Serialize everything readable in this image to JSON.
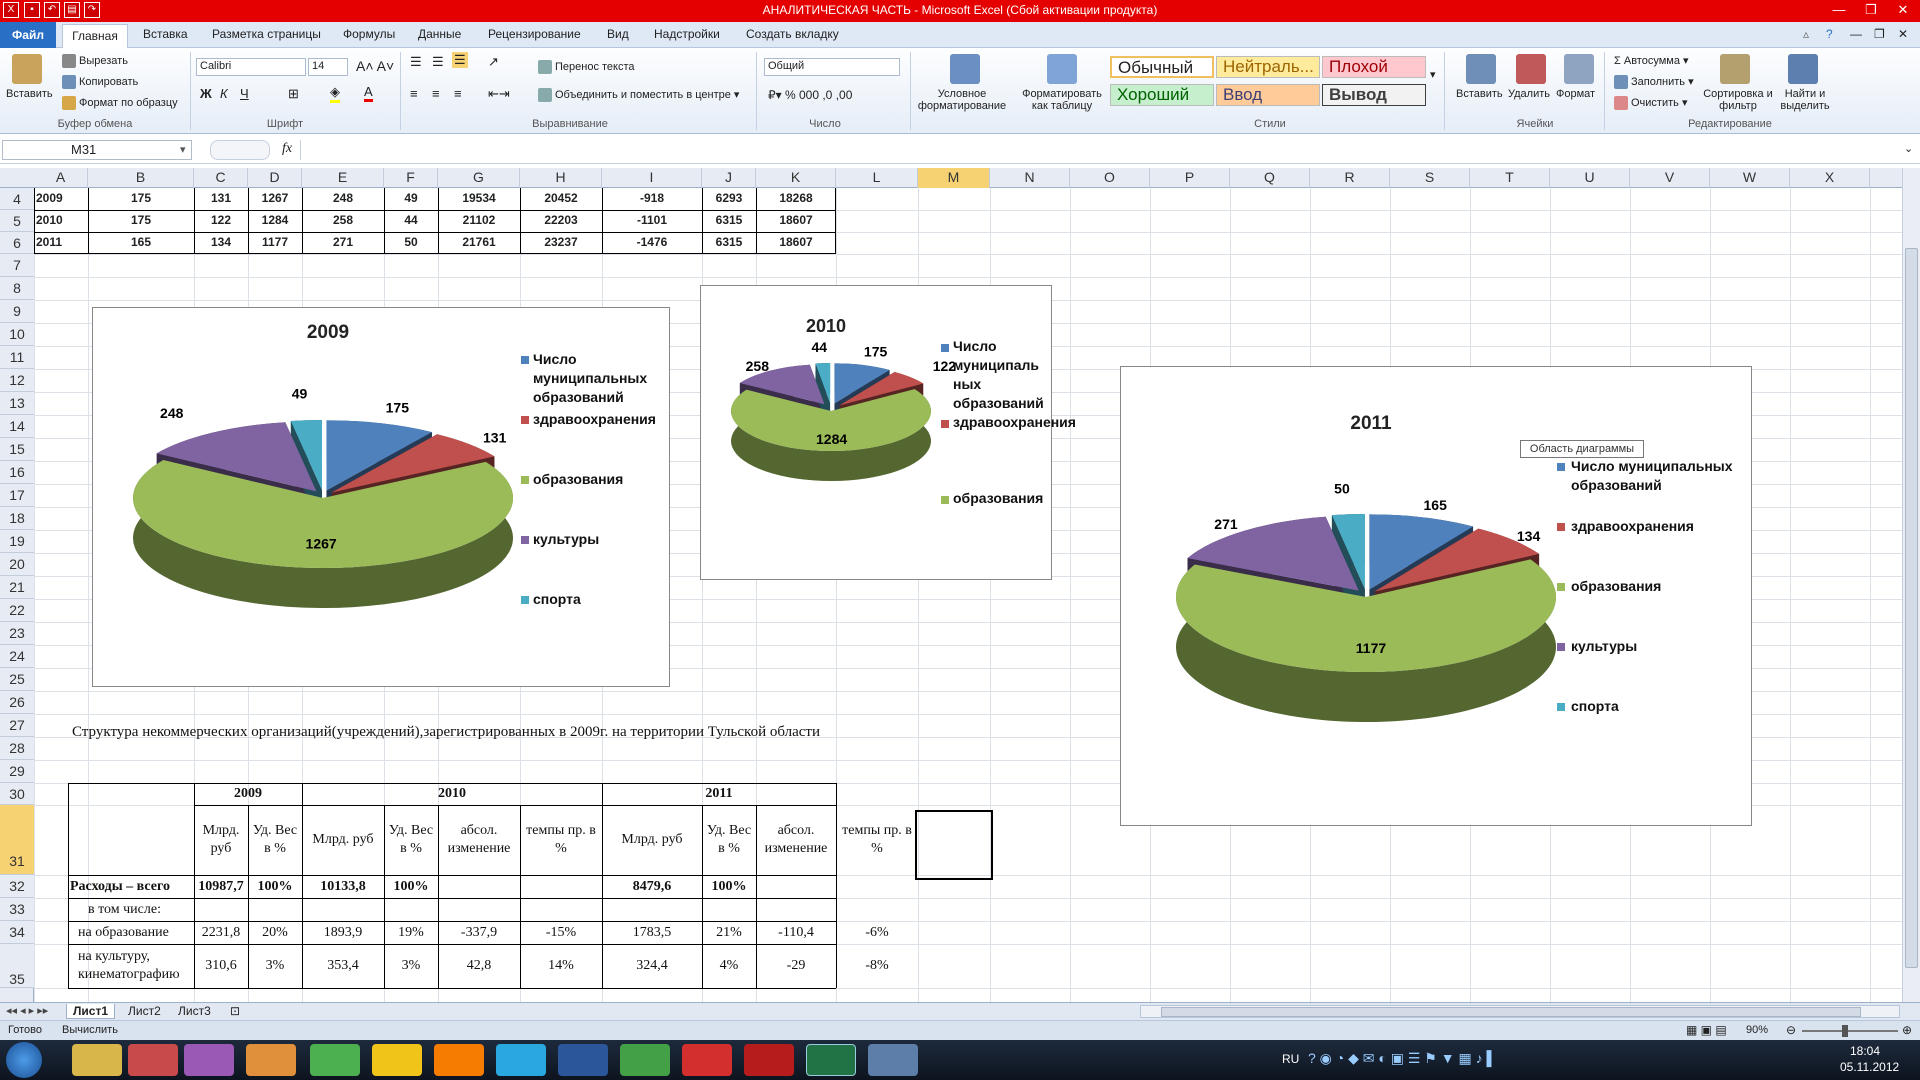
{
  "window": {
    "title": "АНАЛИТИЧЕСКАЯ ЧАСТЬ  -  Microsoft Excel (Сбой активации продукта)"
  },
  "ribbon_tabs": [
    "Файл",
    "Главная",
    "Вставка",
    "Разметка страницы",
    "Формулы",
    "Данные",
    "Рецензирование",
    "Вид",
    "Надстройки",
    "Создать вкладку"
  ],
  "ribbon": {
    "paste": "Вставить",
    "cut": "Вырезать",
    "copy": "Копировать",
    "format_painter": "Формат по образцу",
    "group_clipboard": "Буфер обмена",
    "font_name": "Calibri",
    "font_size": "14",
    "group_font": "Шрифт",
    "wrap": "Перенос текста",
    "merge": "Объединить и поместить в центре",
    "group_align": "Выравнивание",
    "number_format": "Общий",
    "group_number": "Число",
    "cond_format": "Условное форматирование",
    "format_table": "Форматировать как таблицу",
    "styles": [
      "Обычный",
      "Нейтраль...",
      "Плохой",
      "Хороший",
      "Ввод",
      "Вывод"
    ],
    "group_styles": "Стили",
    "insert": "Вставить",
    "delete": "Удалить",
    "format": "Формат",
    "group_cells": "Ячейки",
    "autosum": "Автосумма",
    "fill": "Заполнить",
    "clear": "Очистить",
    "sort": "Сортировка и фильтр",
    "find": "Найти и выделить",
    "group_edit": "Редактирование"
  },
  "formula_bar": {
    "name_box": "M31",
    "fx": "fx",
    "value": ""
  },
  "columns": [
    "A",
    "B",
    "C",
    "D",
    "E",
    "F",
    "G",
    "H",
    "I",
    "J",
    "K",
    "L",
    "M",
    "N",
    "O",
    "P",
    "Q",
    "R",
    "S",
    "T",
    "U",
    "V",
    "W",
    "X"
  ],
  "rows": [
    "4",
    "5",
    "6",
    "7",
    "8",
    "9",
    "10",
    "11",
    "12",
    "13",
    "14",
    "15",
    "16",
    "17",
    "18",
    "19",
    "20",
    "21",
    "22",
    "23",
    "24",
    "25",
    "26",
    "27",
    "28",
    "29",
    "30",
    "31",
    "32",
    "33",
    "34",
    "35"
  ],
  "top_table": [
    [
      "2009",
      "175",
      "131",
      "1267",
      "248",
      "49",
      "19534",
      "20452",
      "-918",
      "6293",
      "18268"
    ],
    [
      "2010",
      "175",
      "122",
      "1284",
      "258",
      "44",
      "21102",
      "22203",
      "-1101",
      "6315",
      "18607"
    ],
    [
      "2011",
      "165",
      "134",
      "1177",
      "271",
      "50",
      "21761",
      "23237",
      "-1476",
      "6315",
      "18607"
    ]
  ],
  "chart_data": [
    {
      "type": "pie",
      "title": "2009",
      "categories": [
        "Число муниципальных образований",
        "здравоохранения",
        "образования",
        "культуры",
        "спорта"
      ],
      "values": [
        175,
        131,
        1267,
        248,
        49
      ],
      "legend": "right"
    },
    {
      "type": "pie",
      "title": "2010",
      "categories": [
        "Число муниципальных образований",
        "здравоохранения",
        "образования"
      ],
      "values": [
        175,
        122,
        1284,
        258,
        44
      ],
      "legend": "right"
    },
    {
      "type": "pie",
      "title": "2011",
      "categories": [
        "Число муниципальных образований",
        "здравоохранения",
        "образования",
        "культуры",
        "спорта"
      ],
      "values": [
        165,
        134,
        1177,
        271,
        50
      ],
      "legend": "right"
    }
  ],
  "chart_labels": {
    "c2009": {
      "title": "2009",
      "legend": [
        "Число муниципальных образований",
        "здравоохранения",
        "образования",
        "культуры",
        "спорта"
      ]
    },
    "c2010": {
      "title": "2010",
      "legend": [
        "Число муниципаль ных образований",
        "здравоохранения",
        "образования"
      ]
    },
    "c2011": {
      "title": "2011",
      "legend": [
        "Число муниципальных образований",
        "здравоохранения",
        "образования",
        "культуры",
        "спорта"
      ]
    }
  },
  "colors": {
    "blue": "#4f81bd",
    "red": "#c0504d",
    "green": "#9bbb59",
    "purple": "#8064a2",
    "cyan": "#4bacc6"
  },
  "tooltip": "Область диаграммы",
  "row27_text": "Структура некоммерческих организаций(учреждений),зарегистрированных в 2009г. на территории Тульской области",
  "bottom_table": {
    "years": [
      "2009",
      "2010",
      "2011"
    ],
    "sub": [
      "Млрд. руб",
      "Уд. Вес в %",
      "Млрд. руб",
      "Уд. Вес в %",
      "абсол. изменение",
      "темпы пр. в %",
      "Млрд. руб",
      "Уд. Вес в %",
      "абсол. изменение",
      "темпы пр. в %"
    ],
    "rows": [
      [
        "Расходы – всего",
        "10987,7",
        "100%",
        "10133,8",
        "100%",
        "",
        "",
        "8479,6",
        "100%",
        "",
        ""
      ],
      [
        "в том числе:",
        "",
        "",
        "",
        "",
        "",
        "",
        "",
        "",
        "",
        ""
      ],
      [
        "на образование",
        "2231,8",
        "20%",
        "1893,9",
        "19%",
        "-337,9",
        "-15%",
        "1783,5",
        "21%",
        "-110,4",
        "-6%"
      ],
      [
        "на культуру, кинематографию",
        "310,6",
        "3%",
        "353,4",
        "3%",
        "42,8",
        "14%",
        "324,4",
        "4%",
        "-29",
        "-8%"
      ]
    ]
  },
  "sheets": [
    "Лист1",
    "Лист2",
    "Лист3"
  ],
  "status": {
    "ready": "Готово",
    "calc": "Вычислить",
    "zoom": "90%"
  },
  "taskbar": {
    "lang": "RU",
    "time": "18:04",
    "date": "05.11.2012"
  }
}
